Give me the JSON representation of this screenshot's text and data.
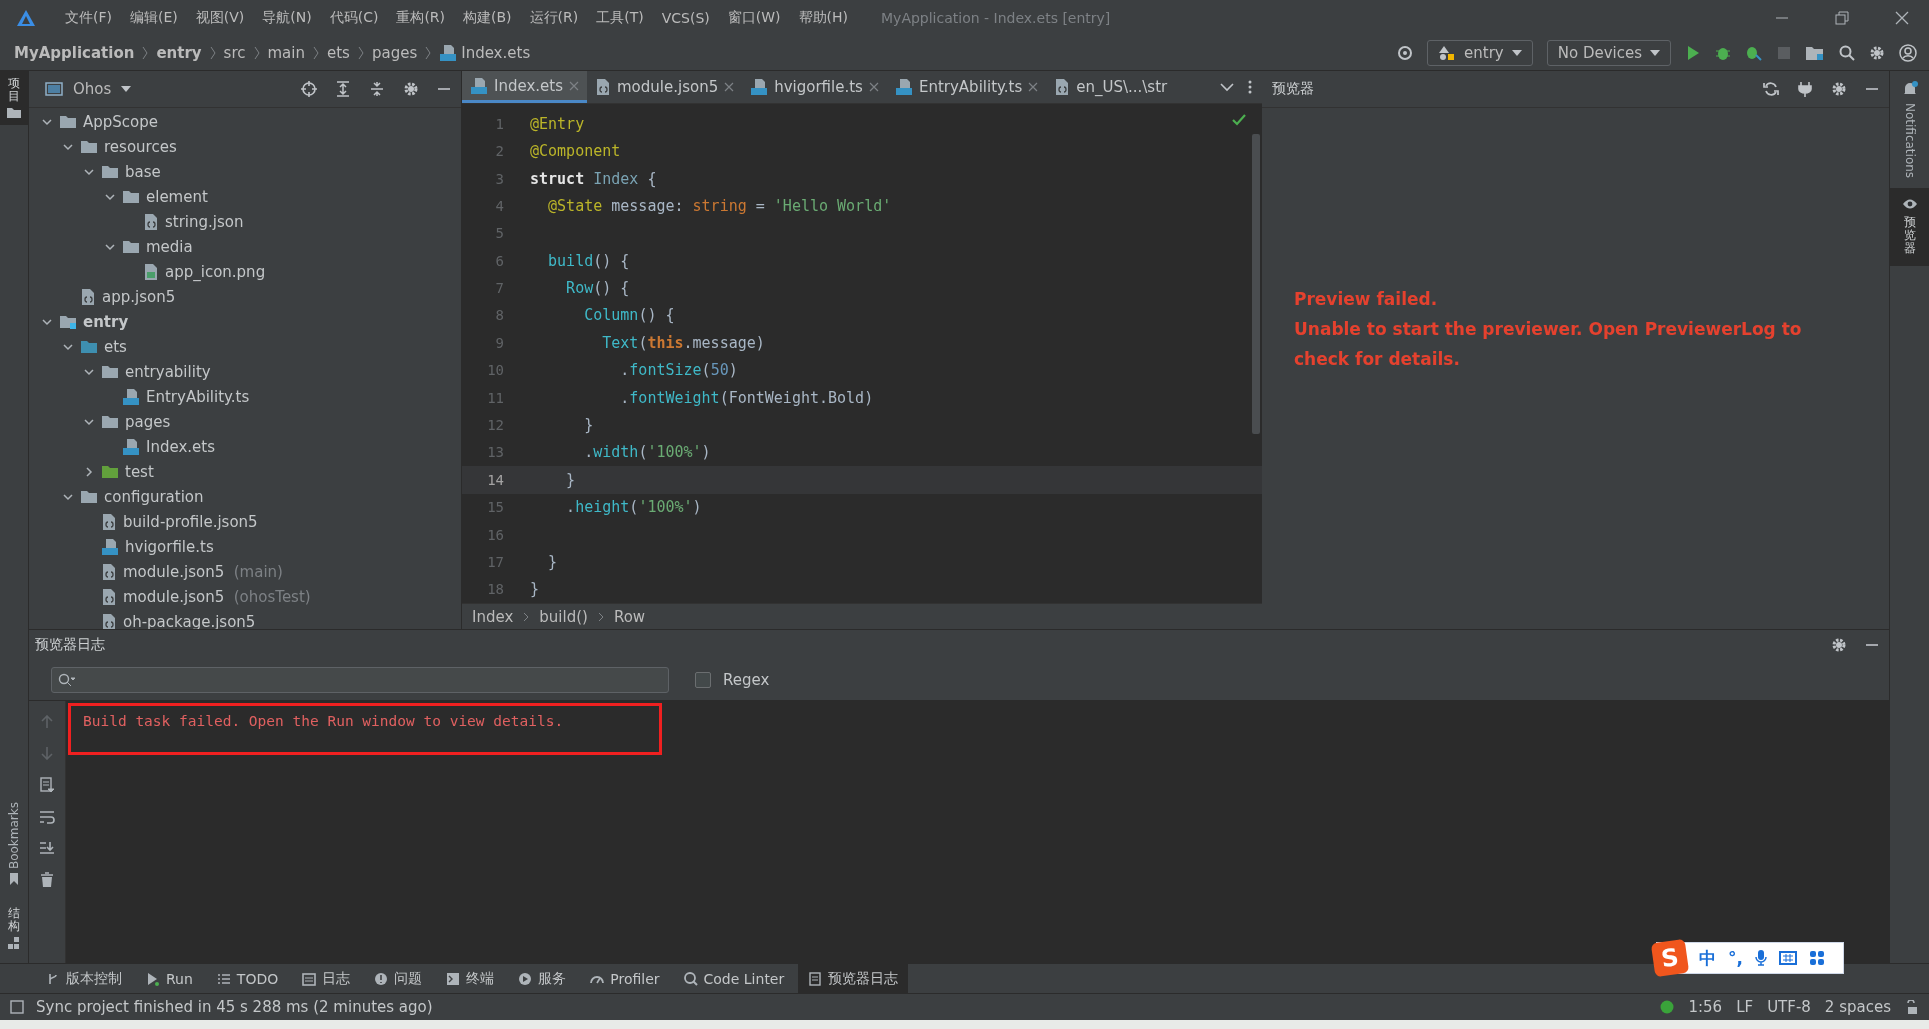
{
  "window": {
    "title": "MyApplication - Index.ets [entry]"
  },
  "menu": [
    "文件(F)",
    "编辑(E)",
    "视图(V)",
    "导航(N)",
    "代码(C)",
    "重构(R)",
    "构建(B)",
    "运行(R)",
    "工具(T)",
    "VCS(S)",
    "窗口(W)",
    "帮助(H)"
  ],
  "breadcrumb": [
    {
      "label": "MyApplication",
      "bold": true
    },
    {
      "label": "entry",
      "bold": true
    },
    {
      "label": "src",
      "bold": false
    },
    {
      "label": "main",
      "bold": false
    },
    {
      "label": "ets",
      "bold": false
    },
    {
      "label": "pages",
      "bold": false
    },
    {
      "label": "Index.ets",
      "bold": false
    }
  ],
  "toolbar": {
    "run_config": "entry",
    "device": "No Devices"
  },
  "left_strip": {
    "top": "项目",
    "bookmarks": "Bookmarks",
    "structure": "结构"
  },
  "right_strip": {
    "notifications": "Notifications",
    "preview": "预览器"
  },
  "project": {
    "title": "Ohos",
    "tree": [
      {
        "label": "AppScope",
        "kind": "folder",
        "bold": false,
        "expanded": true,
        "children": [
          {
            "label": "resources",
            "kind": "folder",
            "bold": false,
            "expanded": true,
            "children": [
              {
                "label": "base",
                "kind": "folder",
                "bold": false,
                "expanded": true,
                "children": [
                  {
                    "label": "element",
                    "kind": "folder",
                    "bold": false,
                    "expanded": true,
                    "children": [
                      {
                        "label": "string.json",
                        "kind": "json",
                        "bold": false
                      }
                    ]
                  },
                  {
                    "label": "media",
                    "kind": "folder",
                    "bold": false,
                    "expanded": true,
                    "children": [
                      {
                        "label": "app_icon.png",
                        "kind": "image",
                        "bold": false
                      }
                    ]
                  }
                ]
              }
            ]
          },
          {
            "label": "app.json5",
            "kind": "json",
            "bold": false
          }
        ]
      },
      {
        "label": "entry",
        "kind": "module",
        "bold": true,
        "expanded": true,
        "children": [
          {
            "label": "ets",
            "kind": "source",
            "bold": false,
            "expanded": true,
            "children": [
              {
                "label": "entryability",
                "kind": "folder",
                "bold": false,
                "expanded": true,
                "children": [
                  {
                    "label": "EntryAbility.ts",
                    "kind": "ts",
                    "bold": false
                  }
                ]
              },
              {
                "label": "pages",
                "kind": "folder",
                "bold": false,
                "expanded": true,
                "children": [
                  {
                    "label": "Index.ets",
                    "kind": "ets",
                    "bold": false
                  }
                ]
              },
              {
                "label": "test",
                "kind": "test",
                "bold": false,
                "expanded": false
              }
            ]
          },
          {
            "label": "configuration",
            "kind": "folder",
            "bold": false,
            "expanded": true,
            "children": [
              {
                "label": "build-profile.json5",
                "kind": "json",
                "bold": false
              },
              {
                "label": "hvigorfile.ts",
                "kind": "ts",
                "bold": false
              },
              {
                "label": "module.json5",
                "hint": "(main)",
                "kind": "json",
                "bold": false
              },
              {
                "label": "module.json5",
                "hint": "(ohosTest)",
                "kind": "json",
                "bold": false
              },
              {
                "label": "oh-package.json5",
                "kind": "json",
                "bold": false
              }
            ]
          }
        ]
      }
    ]
  },
  "editor": {
    "tabs": [
      {
        "label": "Index.ets",
        "kind": "ets",
        "selected": true
      },
      {
        "label": "module.json5",
        "kind": "json",
        "selected": false
      },
      {
        "label": "hvigorfile.ts",
        "kind": "ts",
        "selected": false
      },
      {
        "label": "EntryAbility.ts",
        "kind": "ts",
        "selected": false
      },
      {
        "label": "en_US\\...\\str",
        "kind": "json",
        "selected": false
      }
    ],
    "lines": [
      {
        "number": "1",
        "current": false,
        "tokens": [
          {
            "kind": "annotation",
            "text": "@Entry"
          }
        ]
      },
      {
        "number": "2",
        "current": false,
        "tokens": [
          {
            "kind": "annotation",
            "text": "@Component"
          }
        ]
      },
      {
        "number": "3",
        "current": false,
        "tokens": [
          {
            "kind": "keyword",
            "text": "struct "
          },
          {
            "kind": "type",
            "text": "Index"
          },
          {
            "kind": "plain",
            "text": " {"
          }
        ]
      },
      {
        "number": "4",
        "current": false,
        "tokens": [
          {
            "kind": "annotation",
            "text": "  @State"
          },
          {
            "kind": "plain",
            "text": " message: "
          },
          {
            "kind": "typeword",
            "text": "string"
          },
          {
            "kind": "plain",
            "text": " = "
          },
          {
            "kind": "string",
            "text": "'Hello World'"
          }
        ]
      },
      {
        "number": "5",
        "current": false
      },
      {
        "number": "6",
        "current": false,
        "tokens": [
          {
            "kind": "call",
            "text": "  build"
          },
          {
            "kind": "plain",
            "text": "() {"
          }
        ]
      },
      {
        "number": "7",
        "current": false,
        "tokens": [
          {
            "kind": "call",
            "text": "    Row"
          },
          {
            "kind": "plain",
            "text": "() {"
          }
        ]
      },
      {
        "number": "8",
        "current": false,
        "tokens": [
          {
            "kind": "call",
            "text": "      Column"
          },
          {
            "kind": "plain",
            "text": "() {"
          }
        ]
      },
      {
        "number": "9",
        "current": false,
        "tokens": [
          {
            "kind": "call",
            "text": "        Text"
          },
          {
            "kind": "plain",
            "text": "("
          },
          {
            "kind": "this",
            "text": "this"
          },
          {
            "kind": "plain",
            "text": ".message)"
          }
        ]
      },
      {
        "number": "10",
        "current": false,
        "tokens": [
          {
            "kind": "plain",
            "text": "          ."
          },
          {
            "kind": "call",
            "text": "fontSize"
          },
          {
            "kind": "plain",
            "text": "("
          },
          {
            "kind": "number",
            "text": "50"
          },
          {
            "kind": "plain",
            "text": ")"
          }
        ]
      },
      {
        "number": "11",
        "current": false,
        "tokens": [
          {
            "kind": "plain",
            "text": "          ."
          },
          {
            "kind": "call",
            "text": "fontWeight"
          },
          {
            "kind": "plain",
            "text": "(FontWeight.Bold)"
          }
        ]
      },
      {
        "number": "12",
        "current": false,
        "tokens": [
          {
            "kind": "plain",
            "text": "      }"
          }
        ]
      },
      {
        "number": "13",
        "current": false,
        "tokens": [
          {
            "kind": "plain",
            "text": "      ."
          },
          {
            "kind": "call",
            "text": "width"
          },
          {
            "kind": "plain",
            "text": "("
          },
          {
            "kind": "string",
            "text": "'100%'"
          },
          {
            "kind": "plain",
            "text": ")"
          }
        ]
      },
      {
        "number": "14",
        "current": true,
        "tokens": [
          {
            "kind": "plain",
            "text": "    }"
          }
        ]
      },
      {
        "number": "15",
        "current": false,
        "tokens": [
          {
            "kind": "plain",
            "text": "    ."
          },
          {
            "kind": "call",
            "text": "height"
          },
          {
            "kind": "plain",
            "text": "("
          },
          {
            "kind": "string",
            "text": "'100%'"
          },
          {
            "kind": "plain",
            "text": ")"
          }
        ]
      },
      {
        "number": "16",
        "current": false
      },
      {
        "number": "17",
        "current": false,
        "tokens": [
          {
            "kind": "plain",
            "text": "  }"
          }
        ]
      },
      {
        "number": "18",
        "current": false,
        "tokens": [
          {
            "kind": "plain",
            "text": "}"
          }
        ]
      }
    ],
    "breadcrumb": [
      "Index",
      "build()",
      "Row"
    ]
  },
  "preview": {
    "title": "预览器",
    "messages": [
      "Preview failed.",
      "Unable to start the previewer. Open PreviewerLog to check for details."
    ]
  },
  "log": {
    "title": "预览器日志",
    "regex": {
      "label": "Regex",
      "checked": false
    },
    "messages": [
      "Build task failed. Open the Run window to view details."
    ]
  },
  "tool_windows": [
    {
      "label": "版本控制",
      "kind": "branch",
      "selected": false
    },
    {
      "label": "Run",
      "kind": "run",
      "selected": false
    },
    {
      "label": "TODO",
      "kind": "list",
      "selected": false
    },
    {
      "label": "日志",
      "kind": "calendar",
      "selected": false
    },
    {
      "label": "问题",
      "kind": "alert",
      "selected": false
    },
    {
      "label": "终端",
      "kind": "terminal",
      "selected": false
    },
    {
      "label": "服务",
      "kind": "play",
      "selected": false
    },
    {
      "label": "Profiler",
      "kind": "gauge",
      "selected": false
    },
    {
      "label": "Code Linter",
      "kind": "linter",
      "selected": false
    },
    {
      "label": "预览器日志",
      "kind": "doc",
      "selected": true
    }
  ],
  "status_bar": {
    "message": "Sync project finished in 45 s 288 ms (2 minutes ago)",
    "position": "1:56",
    "line_ending": "LF",
    "encoding": "UTF-8",
    "indent": "2 spaces"
  },
  "ime": {
    "logo": "S",
    "mode": "中",
    "punct": "°,"
  }
}
